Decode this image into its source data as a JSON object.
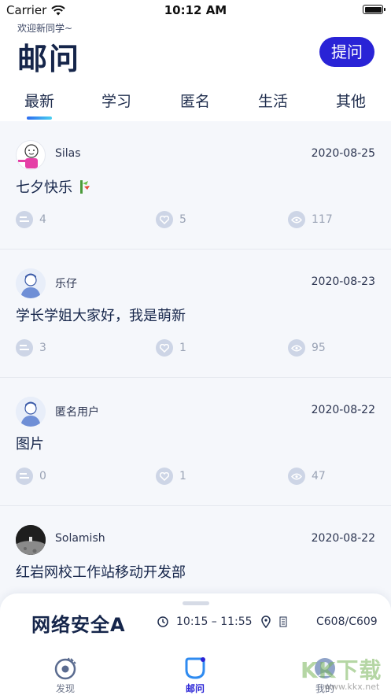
{
  "status_bar": {
    "carrier": "Carrier",
    "time": "10:12 AM"
  },
  "header": {
    "welcome": "欢迎新同学~",
    "title": "邮问",
    "ask_button": "提问"
  },
  "tabs": [
    {
      "label": "最新",
      "active": true
    },
    {
      "label": "学习",
      "active": false
    },
    {
      "label": "匿名",
      "active": false
    },
    {
      "label": "生活",
      "active": false
    },
    {
      "label": "其他",
      "active": false
    }
  ],
  "posts": [
    {
      "author": "Silas",
      "date": "2020-08-25",
      "content": "七夕快乐",
      "comments": "4",
      "likes": "5",
      "views": "117",
      "avatar": "cartoon-avatar"
    },
    {
      "author": "乐仔",
      "date": "2020-08-23",
      "content": "学长学姐大家好，我是萌新",
      "comments": "3",
      "likes": "1",
      "views": "95",
      "avatar": "default-avatar"
    },
    {
      "author": "匿名用户",
      "date": "2020-08-22",
      "content": "图片",
      "comments": "0",
      "likes": "1",
      "views": "47",
      "avatar": "default-avatar"
    },
    {
      "author": "Solamish",
      "date": "2020-08-22",
      "content": "红岩网校工作站移动开发部",
      "avatar": "moon-avatar"
    }
  ],
  "course_card": {
    "name": "网络安全A",
    "time": "10:15 – 11:55",
    "location": "C608/C609"
  },
  "bottom_nav": [
    {
      "label": "发现",
      "icon": "discover-icon",
      "active": false
    },
    {
      "label": "邮问",
      "icon": "youwen-icon",
      "active": true
    },
    {
      "label": "我的",
      "icon": "profile-icon",
      "active": false
    }
  ],
  "watermark": {
    "text": "KK下载",
    "url": "www.kkx.net"
  },
  "colors": {
    "accent": "#2923d6",
    "title": "#15254a",
    "muted": "#9aa3b5"
  }
}
